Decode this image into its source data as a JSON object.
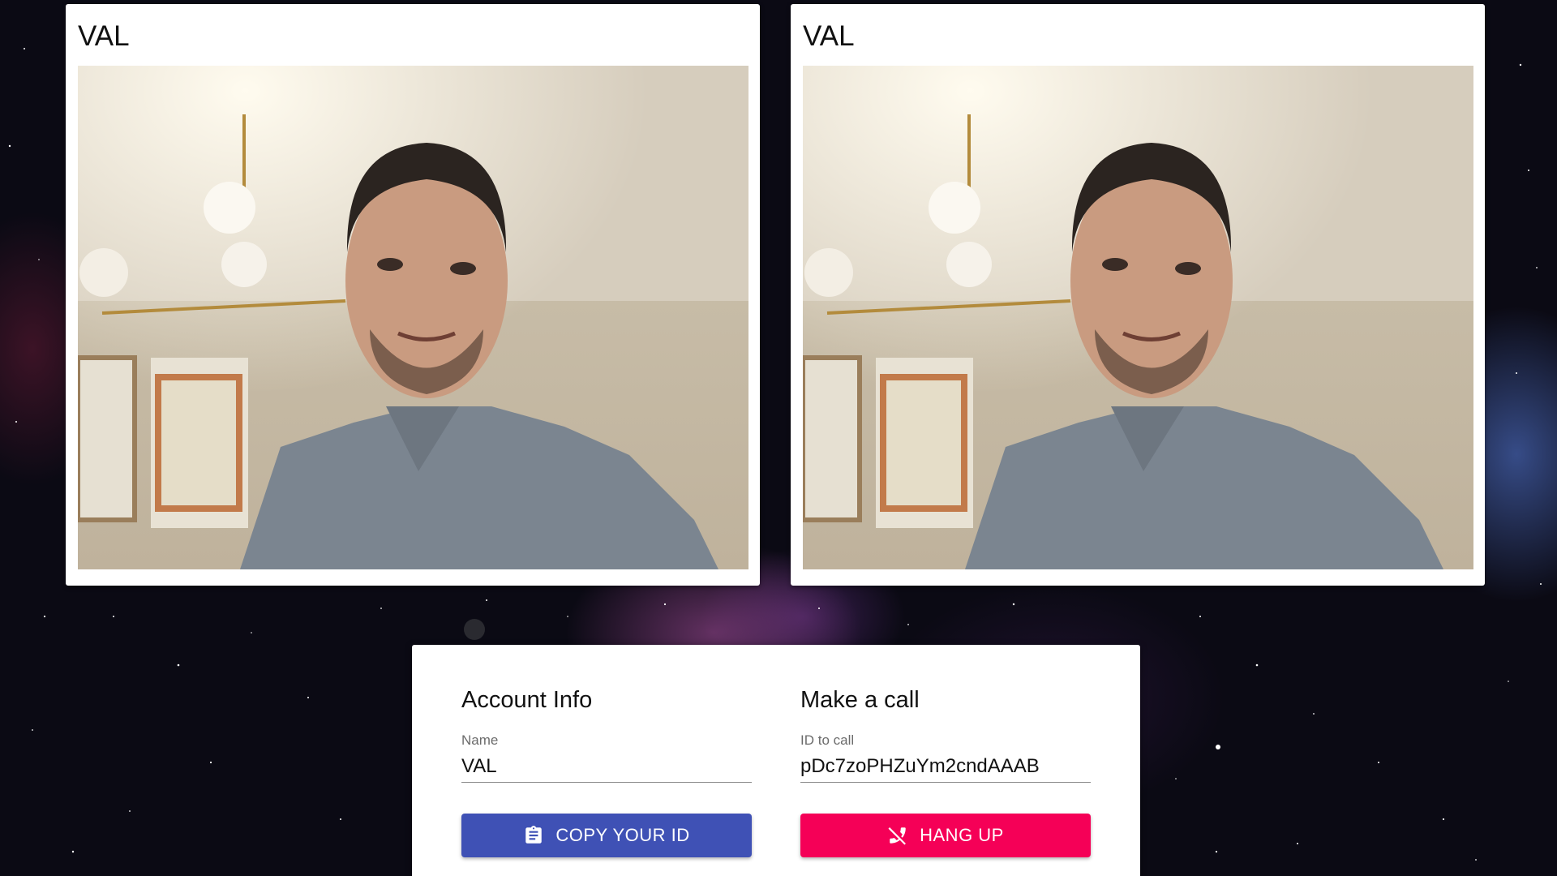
{
  "videos": {
    "left": {
      "caller_name": "VAL"
    },
    "right": {
      "caller_name": "VAL"
    }
  },
  "account_info": {
    "heading": "Account Info",
    "name_label": "Name",
    "name_value": "VAL",
    "copy_button_label": "COPY YOUR ID",
    "copy_button_icon": "clipboard-icon"
  },
  "make_call": {
    "heading": "Make a call",
    "id_label": "ID to call",
    "id_value": "pDc7zoPHZuYm2cndAAAB",
    "hangup_button_label": "HANG UP",
    "hangup_button_icon": "phone-disabled-icon"
  },
  "colors": {
    "copy_button": "#3f51b5",
    "hangup_button": "#f50057",
    "background": "#0b0a14"
  }
}
